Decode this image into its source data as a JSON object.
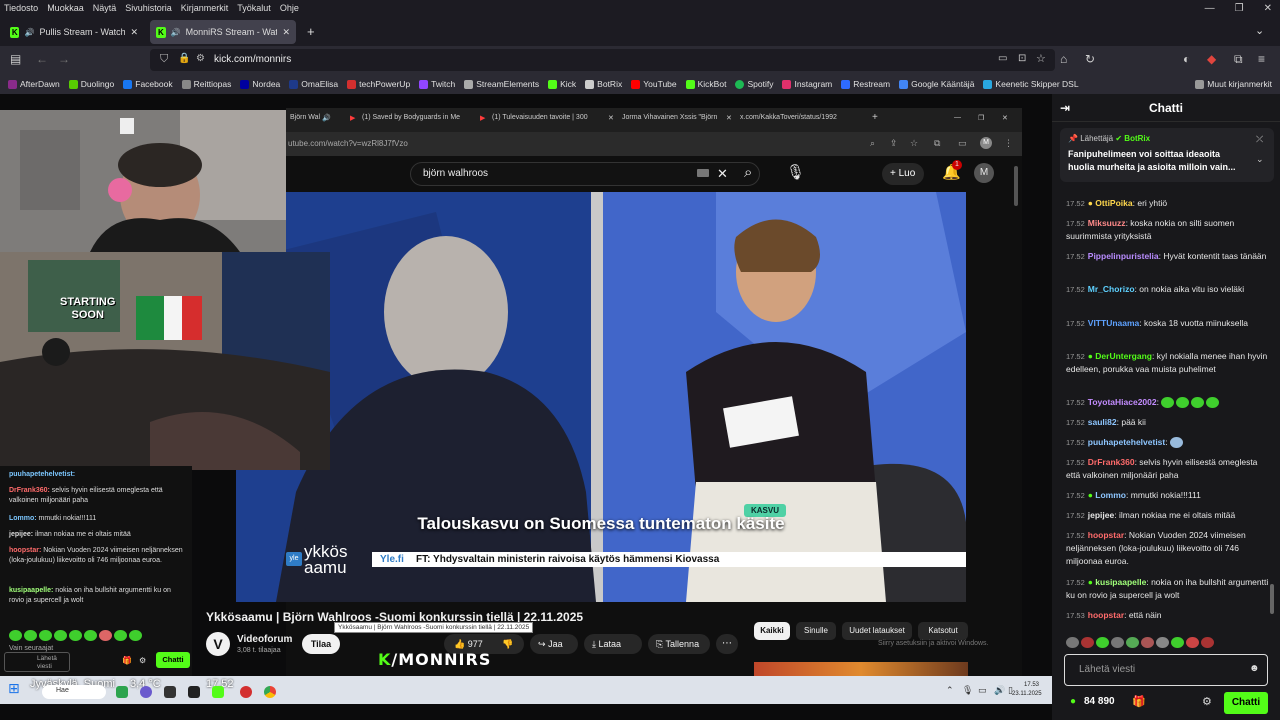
{
  "menubar": {
    "items": [
      "Tiedosto",
      "Muokkaa",
      "Näytä",
      "Sivuhistoria",
      "Kirjanmerkit",
      "Työkalut",
      "Ohje"
    ]
  },
  "tabs": [
    {
      "label": "Pullis Stream - Watch Live o"
    },
    {
      "label": "MonniRS Stream - Watch Li"
    }
  ],
  "address": {
    "url": "kick.com/monnirs"
  },
  "bookmarks": [
    {
      "label": "AfterDawn",
      "color": "#8a2b8a"
    },
    {
      "label": "Duolingo",
      "color": "#58cc02"
    },
    {
      "label": "Facebook",
      "color": "#1877f2"
    },
    {
      "label": "Reittiopas",
      "color": "#cccccc"
    },
    {
      "label": "Nordea",
      "color": "#0000a0"
    },
    {
      "label": "OmaElisa",
      "color": "#1e3a8a"
    },
    {
      "label": "techPowerUp",
      "color": "#d32f2f"
    },
    {
      "label": "Twitch",
      "color": "#9146ff"
    },
    {
      "label": "StreamElements",
      "color": "#aaaaaa"
    },
    {
      "label": "Kick",
      "color": "#53fc18"
    },
    {
      "label": "BotRix",
      "color": "#cccccc"
    },
    {
      "label": "YouTube",
      "color": "#ff0000"
    },
    {
      "label": "KickBot",
      "color": "#53fc18"
    },
    {
      "label": "Spotify",
      "color": "#1db954"
    },
    {
      "label": "Instagram",
      "color": "#e1306c"
    },
    {
      "label": "Restream",
      "color": "#2e6bff"
    },
    {
      "label": "Google Kääntäjä",
      "color": "#4285f4"
    },
    {
      "label": "Keenetic Skipper DSL",
      "color": "#29a7e0"
    }
  ],
  "bookmarks_other": "Muut kirjanmerkit",
  "yt": {
    "tabs": [
      "Björn Wal",
      "(1) Saved by Bodyguards in Me",
      "(1) Tulevaisuuden tavoite | 300",
      "Jorma Vihavainen Xssis \"Björn",
      "x.com/KakkaToveri/status/1992"
    ],
    "url": "utube.com/watch?v=wzRl8J7fVzo",
    "search": "björn walhroos",
    "create_label": "Luo",
    "notif_count": "1",
    "avatar": "M",
    "caption_tag": "KASVU",
    "caption_headline": "Talouskasvu on Suomessa tuntematon käsite",
    "ticker_source": "Yle.fi",
    "ticker_text": "FT: Yhdysvaltain ministerin raivoisa käytös hämmensi Kiovassa",
    "logo_line1": "ykkös",
    "logo_line2": "aamu",
    "logo_yle": "yle",
    "video_title": "Ykkösaamu | Björn Wahlroos -Suomi konkurssin tiellä | 22.11.2025",
    "tooltip": "Ykkösaamu | Björn Wahlroos -Suomi konkurssin tiellä | 22.11.2025",
    "channel": "Videoforum",
    "subs": "3,08 t. tilaajaa",
    "subscribe": "Tilaa",
    "likes": "977",
    "share": "Jaa",
    "download": "Lataa",
    "save": "Tallenna",
    "chips": [
      "Kaikki",
      "Sinulle",
      "Uudet lataukset",
      "Katsotut"
    ],
    "activate": "Siirry asetuksiin ja aktivoi Windows."
  },
  "overlay_brand": "/MONNIRS",
  "cam2_sign": [
    "STARTING",
    "SOON"
  ],
  "left_chat": {
    "messages": [
      {
        "user": "puuhapetehelvetist:",
        "color": "#7cc7ff",
        "text": ""
      },
      {
        "user": "DrFrank360:",
        "color": "#ff6b6b",
        "text": " selvis hyvin eilisestä omeglesta että valkoinen miljonääri paha"
      },
      {
        "user": "Lommo:",
        "color": "#7cc7ff",
        "text": " mmutki nokia!!!111"
      },
      {
        "user": "jepijee:",
        "color": "#dddddd",
        "text": " ilman nokiaa me ei oltais mitää"
      },
      {
        "user": "hoopstar:",
        "color": "#ff6b6b",
        "text": " Nokian Vuoden 2024 viimeisen neljänneksen (loka-joulukuu) liikevoitto oli 746 miljoonaa euroa."
      },
      {
        "user": "kusipaapelle:",
        "color": "#a0ff7a",
        "text": " nokia on iha bullshit argumentti ku on rovio ja supercell ja wolt"
      }
    ],
    "followers_note": "Vain seuraajat",
    "send_label": "Lähetä viesti",
    "chat_button": "Chatti"
  },
  "chat": {
    "title": "Chatti",
    "pinned_by": "Lähettäjä",
    "pinned_user": "BotRix",
    "pinned_text": "Fanipuhelimeen voi soittaa ideaoita huolia murheita ja asioita milloin vain...",
    "messages": [
      {
        "time": "17.52",
        "user": "OttiPoika",
        "color": "#ffd84d",
        "text": "eri yhtiö"
      },
      {
        "time": "17.52",
        "user": "Miksuuzz",
        "color": "#ff8a8a",
        "text": "koska nokia on silti suomen suurimmista yrityksistä"
      },
      {
        "time": "17.52",
        "user": "Pippelinpuristelia",
        "color": "#b98cff",
        "text": "Hyvät kontentit taas tänään"
      },
      {
        "time": "17.52",
        "user": "Mr_Chorizo",
        "color": "#5ed1ff",
        "text": "on nokia aika vitu iso vieläki"
      },
      {
        "time": "17.52",
        "user": "VITTUnaama",
        "color": "#5ea2ff",
        "text": "koska 18 vuotta miinuksella"
      },
      {
        "time": "17.52",
        "user": "DerUntergang",
        "color": "#53fc18",
        "text": "kyl nokialla menee ihan hyvin edelleen, porukka vaa muista puhelimet"
      },
      {
        "time": "17.52",
        "user": "ToyotaHiace2002",
        "color": "#c38cff",
        "text": ""
      },
      {
        "time": "17.52",
        "user": "sauli82",
        "color": "#8ec6ff",
        "text": "pää kii"
      },
      {
        "time": "17.52",
        "user": "puuhapetehelvetist",
        "color": "#8ec6ff",
        "text": ""
      },
      {
        "time": "17.52",
        "user": "DrFrank360",
        "color": "#ff6b6b",
        "text": "selvis hyvin eilisestä omeglesta että valkoinen miljonääri paha"
      },
      {
        "time": "17.52",
        "user": "Lommo",
        "color": "#8ec6ff",
        "text": "mmutki nokia!!!111"
      },
      {
        "time": "17.52",
        "user": "jepijee",
        "color": "#e6e6e6",
        "text": "ilman nokiaa me ei oltais mitää"
      },
      {
        "time": "17.52",
        "user": "hoopstar",
        "color": "#ff6b6b",
        "text": "Nokian Vuoden 2024 viimeisen neljänneksen (loka-joulukuu) liikevoitto oli 746 miljoonaa euroa."
      },
      {
        "time": "17.52",
        "user": "kusipaapelle",
        "color": "#a0ff7a",
        "text": "nokia on iha bullshit argumentti ku on rovio ja supercell ja wolt"
      },
      {
        "time": "17.53",
        "user": "hoopstar",
        "color": "#ff6b6b",
        "text": "että näin"
      }
    ],
    "input_placeholder": "Lähetä viesti",
    "viewers": "84 890",
    "send_button": "Chatti"
  },
  "taskbar": {
    "weather": "Jyväskylä, Suomi",
    "temp": "3,4 °C",
    "clock_overlay": "17.52",
    "search": "Hae",
    "time": "17.53",
    "date": "23.11.2025"
  }
}
